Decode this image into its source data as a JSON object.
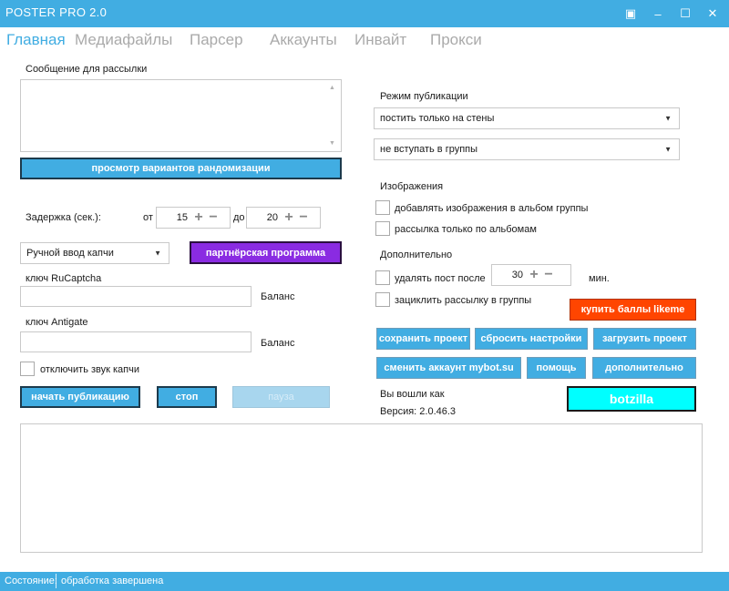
{
  "window": {
    "title": "POSTER PRO 2.0",
    "controls": [
      "▣",
      "–",
      "☐",
      "✕"
    ]
  },
  "tabs": [
    {
      "label": "Главная",
      "active": true
    },
    {
      "label": "Медиафайлы",
      "active": false
    },
    {
      "label": "Парсер",
      "active": false
    },
    {
      "label": "Аккаунты",
      "active": false
    },
    {
      "label": "Инвайт",
      "active": false
    },
    {
      "label": "Прокси",
      "active": false
    }
  ],
  "left": {
    "message_label": "Сообщение для рассылки",
    "message_value": "",
    "preview_button": "просмотр вариантов рандомизации",
    "delay_label": "Задержка  (сек.):",
    "from_label": "от",
    "from_value": "15",
    "to_label": "до",
    "to_value": "20",
    "captcha_mode": "Ручной ввод капчи",
    "partner_button": "партнёрская программа",
    "rucaptcha_label": "ключ RuCaptcha",
    "rucaptcha_value": "",
    "balance1_label": "Баланс",
    "antigate_label": "ключ Antigate",
    "antigate_value": "",
    "balance2_label": "Баланс",
    "mute_captcha_label": "отключить звук капчи",
    "start_button": "начать публикацию",
    "stop_button": "стоп",
    "pause_button": "пауза"
  },
  "right": {
    "mode_label": "Режим публикации",
    "mode_value": "постить только на стены",
    "groups_value": "не вступать в группы",
    "images_label": "Изображения",
    "add_images_label": "добавлять изображения в альбом группы",
    "albums_only_label": "рассылка только по альбомам",
    "extra_label": "Дополнительно",
    "delete_post_label": "удалять пост после",
    "delete_minutes_value": "30",
    "minutes_label": "мин.",
    "loop_label": "зациклить рассылку в группы",
    "buy_likeme_button": "купить баллы likeme",
    "save_project_button": "сохранить проект",
    "reset_settings_button": "сбросить настройки",
    "load_project_button": "загрузить проект",
    "change_account_button": "сменить аккаунт mybot.su",
    "help_button": "помощь",
    "additional_button": "дополнительно",
    "logged_in_label": "Вы вошли как",
    "version_label": "Версия: 2.0.46.3",
    "botzilla_button": "botzilla"
  },
  "status": {
    "label": "Состояние:",
    "value": "обработка завершена"
  },
  "colors": {
    "accent": "#41ade2",
    "purple": "#8a2be2",
    "orange": "#ff4500",
    "cyan": "#00ffff"
  }
}
